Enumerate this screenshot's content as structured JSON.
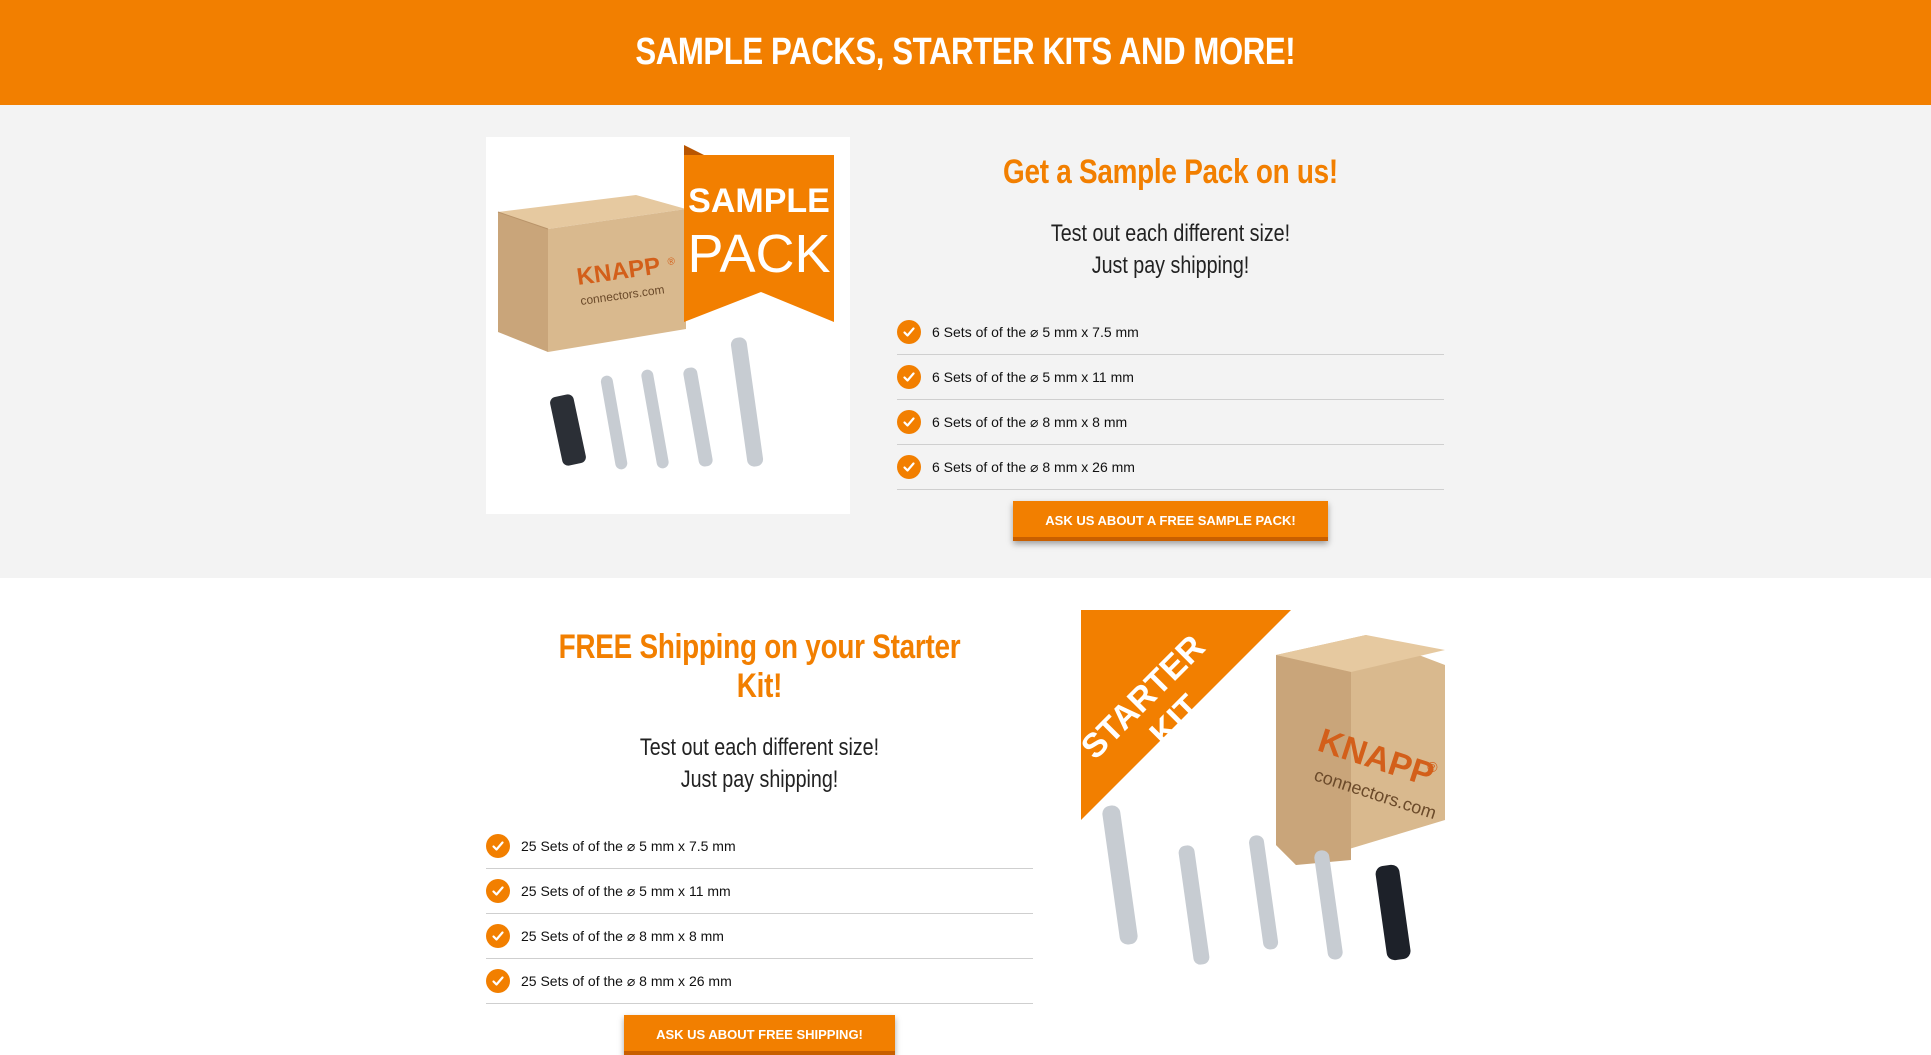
{
  "banner": {
    "title": "SAMPLE PACKS, STARTER KITS AND MORE!"
  },
  "sample": {
    "ribbon_line1": "SAMPLE",
    "ribbon_line2": "PACK",
    "box_brand": "KNAPP",
    "box_brand_mark": "®",
    "box_site": "connectors.com",
    "heading": "Get a Sample Pack on us!",
    "sub_line1": "Test out each different size!",
    "sub_line2": "Just pay shipping!",
    "items": [
      "6 Sets of of the ⌀ 5 mm x 7.5 mm",
      "6 Sets of of the ⌀ 5 mm x 11 mm",
      "6 Sets of of the ⌀ 8 mm x 8 mm",
      "6 Sets of of the ⌀ 8 mm x 26 mm"
    ],
    "button_label": "ASK US ABOUT A FREE SAMPLE PACK!"
  },
  "starter": {
    "ribbon_line1": "STARTER",
    "ribbon_line2": "KIT",
    "box_brand": "KNAPP",
    "box_brand_mark": "®",
    "box_site": "connectors.com",
    "heading": "FREE Shipping on your Starter Kit!",
    "sub_line1": "Test out each different size!",
    "sub_line2": "Just pay shipping!",
    "items": [
      "25 Sets of of the ⌀ 5 mm x 7.5 mm",
      "25 Sets of of the ⌀ 5 mm x 11 mm",
      "25 Sets of of the ⌀ 8 mm x 8 mm",
      "25 Sets of of the ⌀ 8 mm x 26 mm"
    ],
    "button_label": "ASK US ABOUT FREE SHIPPING!"
  },
  "colors": {
    "accent": "#f27f00",
    "accent_dark": "#c85f00",
    "gray_bg": "#f3f3f3"
  },
  "icons": {
    "check": "check-circle-icon"
  }
}
